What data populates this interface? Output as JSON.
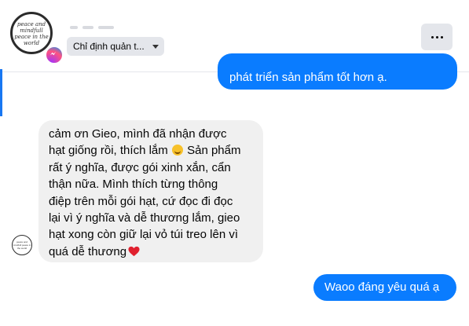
{
  "header": {
    "assign_label": "Chỉ định quản t...",
    "avatar_logo_text": "peace and mindfull peace in the world",
    "more_label": "More"
  },
  "messages": {
    "outgoing_top": "phát triển sản phẩm tốt hơn ạ.",
    "incoming_lines": [
      "cảm ơn Gieo, mình đã nhận được",
      "hạt giống rồi, thích lắm",
      "Sản phẩm",
      "rất ý nghĩa, được gói xinh xắn, cẩn",
      "thận nữa. Mình thích từng thông",
      "điệp trên mỗi gói hạt, cứ đọc đi đọc",
      "lại vì ý nghĩa và dễ thương lắm, gieo",
      "hạt xong còn giữ lại vỏ túi treo lên vì",
      "quá dễ thương"
    ],
    "outgoing_reply": "Waoo đáng yêu quá ạ"
  },
  "colors": {
    "outgoing_bubble": "#0a7cff",
    "incoming_bubble": "#f0f0f0",
    "button_bg": "#e4e6eb"
  },
  "icons": {
    "messenger_badge": "messenger-icon",
    "smile_emoji": "smiling-face-emoji",
    "heart_emoji": "red-heart-emoji",
    "more": "more-dots-icon",
    "dropdown": "caret-down-icon"
  }
}
